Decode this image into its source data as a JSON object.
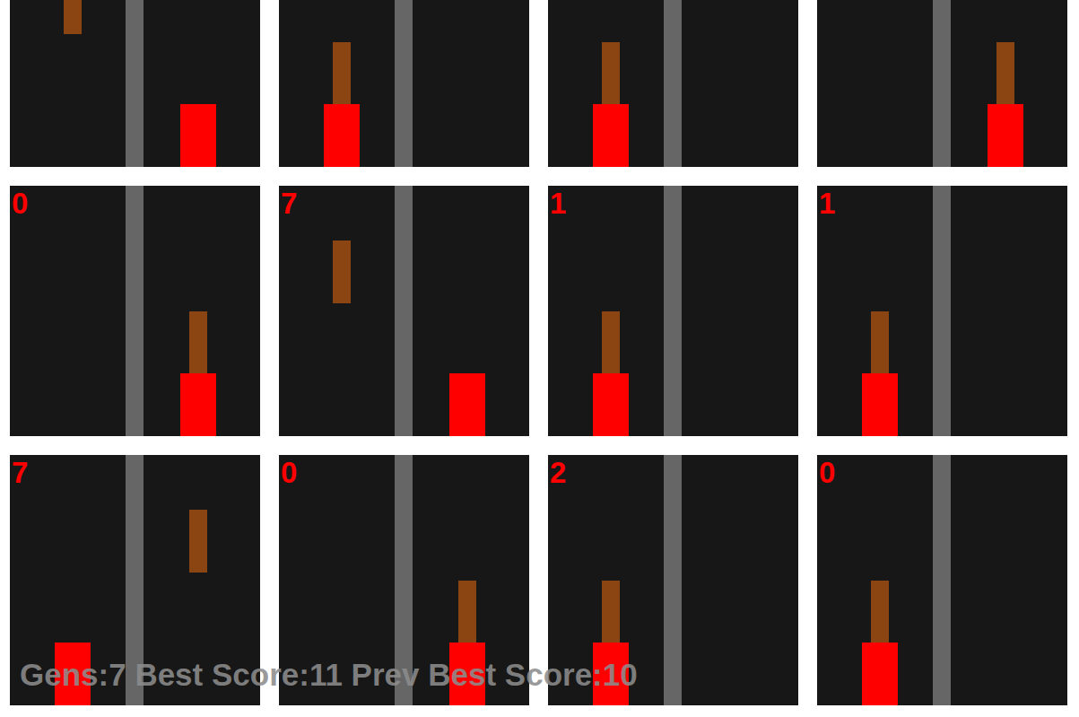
{
  "panels": [
    {
      "player_lane": "right",
      "obstacle_lane": "left",
      "obstacle_level": 0.29
    },
    {
      "player_lane": "left",
      "obstacle_lane": "left",
      "obstacle_level": 0.67
    },
    {
      "player_lane": "left",
      "obstacle_lane": "left",
      "obstacle_level": 0.67
    },
    {
      "player_lane": "right",
      "obstacle_lane": "right",
      "obstacle_level": 0.67
    },
    {
      "score": "0",
      "player_lane": "right",
      "obstacle_lane": "right",
      "obstacle_level": 0.67
    },
    {
      "score": "7",
      "player_lane": "right",
      "obstacle_lane": "left",
      "obstacle_level": 0.29
    },
    {
      "score": "1",
      "player_lane": "left",
      "obstacle_lane": "left",
      "obstacle_level": 0.67
    },
    {
      "score": "1",
      "player_lane": "left",
      "obstacle_lane": "left",
      "obstacle_level": 0.67
    },
    {
      "score": "7",
      "player_lane": "left",
      "obstacle_lane": "right",
      "obstacle_level": 0.29
    },
    {
      "score": "0",
      "player_lane": "right",
      "obstacle_lane": "right",
      "obstacle_level": 0.67
    },
    {
      "score": "2",
      "player_lane": "left",
      "obstacle_lane": "left",
      "obstacle_level": 0.67
    },
    {
      "score": "0",
      "player_lane": "left",
      "obstacle_lane": "left",
      "obstacle_level": 0.67
    }
  ],
  "status_bar": "Gens:7 Best Score:11 Prev Best Score:10"
}
